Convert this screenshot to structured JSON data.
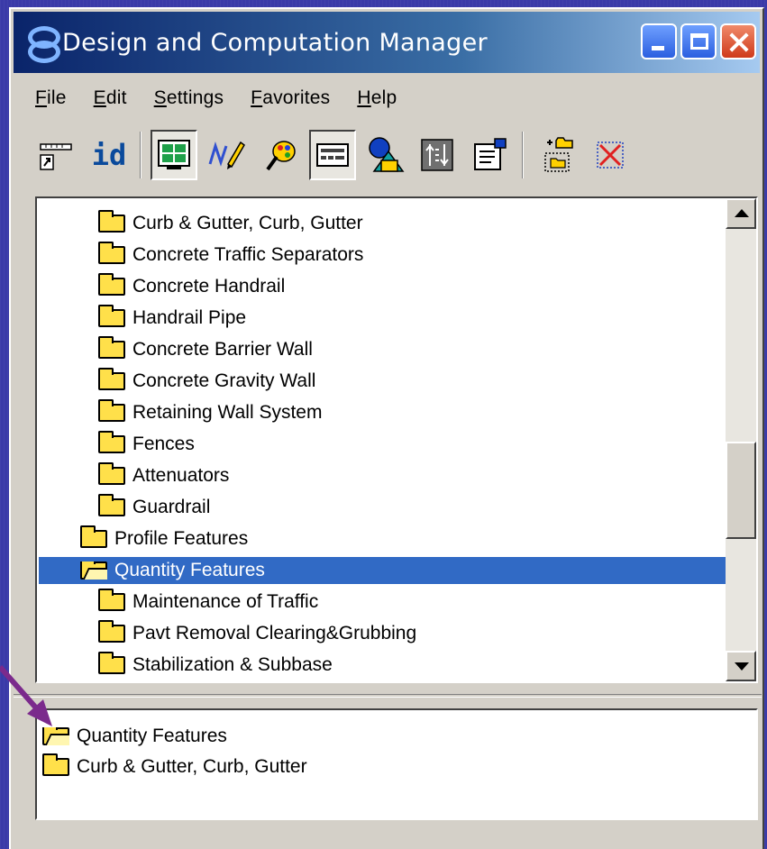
{
  "window": {
    "title": "Design and Computation Manager",
    "controls": {
      "minimize": "minimize-button",
      "maximize": "maximize-button",
      "close": "close-button"
    }
  },
  "menu": [
    {
      "label": "File"
    },
    {
      "label": "Edit"
    },
    {
      "label": "Settings"
    },
    {
      "label": "Favorites"
    },
    {
      "label": "Help"
    }
  ],
  "toolbar": {
    "id_label": "id",
    "tools": [
      "ruler-link-icon",
      "id-icon",
      "display-icon",
      "pencil-icon",
      "palette-icon",
      "keypad-icon",
      "shapes-icon",
      "pattern-icon",
      "properties-icon",
      "new-folder-icon",
      "delete-icon"
    ]
  },
  "tree": {
    "items": [
      {
        "label": "Curb & Gutter, Curb, Gutter",
        "level": 2
      },
      {
        "label": "Concrete Traffic Separators",
        "level": 2
      },
      {
        "label": "Concrete Handrail",
        "level": 2
      },
      {
        "label": "Handrail Pipe",
        "level": 2
      },
      {
        "label": "Concrete Barrier Wall",
        "level": 2
      },
      {
        "label": "Concrete Gravity Wall",
        "level": 2
      },
      {
        "label": "Retaining Wall System",
        "level": 2
      },
      {
        "label": "Fences",
        "level": 2
      },
      {
        "label": "Attenuators",
        "level": 2
      },
      {
        "label": "Guardrail",
        "level": 2
      },
      {
        "label": "Profile Features",
        "level": 1
      },
      {
        "label": "Quantity Features",
        "level": 1,
        "selected": true,
        "open": true
      },
      {
        "label": "Maintenance of Traffic",
        "level": 2
      },
      {
        "label": "Pavt Removal Clearing&Grubbing",
        "level": 2
      },
      {
        "label": "Stabilization & Subbase",
        "level": 2
      }
    ]
  },
  "detail": {
    "items": [
      {
        "label": "Quantity Features",
        "open": true
      },
      {
        "label": "Curb & Gutter, Curb, Gutter"
      }
    ]
  },
  "colors": {
    "selection": "#316ac5",
    "folder": "#ffe04a",
    "arrow": "#7b2a8c",
    "desktop": "#3a3aa8"
  }
}
